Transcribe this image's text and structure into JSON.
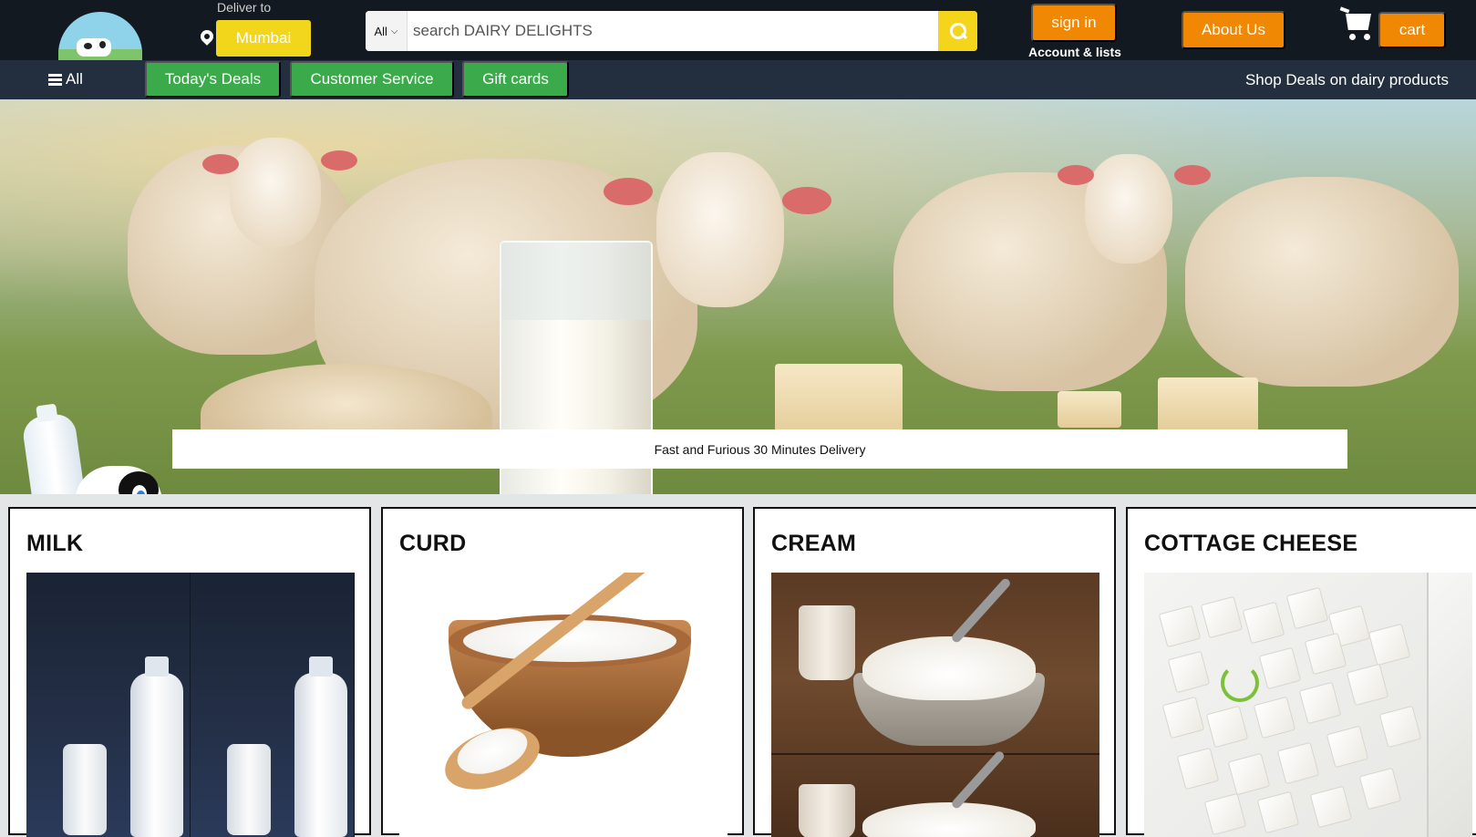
{
  "header": {
    "deliver_label": "Deliver to",
    "location": "Mumbai",
    "search": {
      "category": "All",
      "placeholder": "search DAIRY DELIGHTS"
    },
    "signin_label": "sign in",
    "account_label": "Account & lists",
    "about_label": "About Us",
    "cart_label": "cart"
  },
  "subnav": {
    "all_label": "All",
    "items": [
      "Today's Deals",
      "Customer Service",
      "Gift cards"
    ],
    "promo": "Shop Deals on dairy products"
  },
  "hero": {
    "banner_text": "Fast and Furious 30 Minutes Delivery"
  },
  "products": [
    {
      "title": "MILK"
    },
    {
      "title": "CURD"
    },
    {
      "title": "CREAM"
    },
    {
      "title": "COTTAGE CHEESE"
    }
  ],
  "colors": {
    "header_bg": "#131921",
    "subnav_bg": "#232f3e",
    "accent_orange": "#f08804",
    "accent_yellow": "#f2d61c",
    "nav_green": "#3aaa4a"
  }
}
